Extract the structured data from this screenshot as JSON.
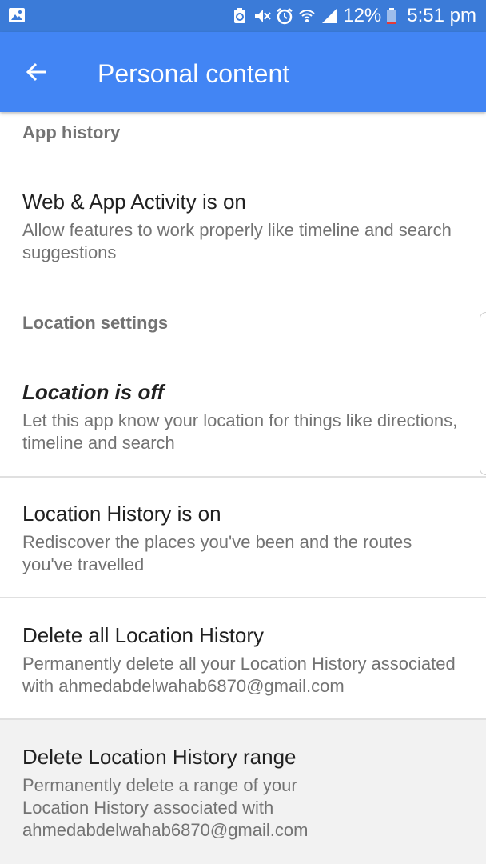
{
  "status_bar": {
    "battery": "12%",
    "time": "5:51 pm",
    "icons": [
      "image-icon",
      "sync-icon",
      "mute-icon",
      "alarm-icon",
      "wifi-icon",
      "signal-icon",
      "battery-icon"
    ]
  },
  "app_bar": {
    "title": "Personal content",
    "back_icon": "arrow-left-icon"
  },
  "sections": {
    "app_history": "App history",
    "location_settings": "Location settings"
  },
  "items": {
    "web_app_activity": {
      "title": "Web & App Activity is on",
      "subtitle": "Allow features to work properly like timeline and search suggestions"
    },
    "location": {
      "title": "Location is off",
      "subtitle": "Let this app know your location for things like directions, timeline and search"
    },
    "location_history": {
      "title": "Location History is on",
      "subtitle": "Rediscover the places you've been and the routes you've travelled"
    },
    "delete_all": {
      "title": "Delete all Location History",
      "subtitle": "Permanently delete all your Location History associ­ated with ahmedabdelwahab6870@gmail.com"
    },
    "delete_range": {
      "title": "Delete Location History range",
      "subtitle": "Permanently delete a range of your Location History associated with ahmedabdelwahab6870@gmail.com"
    }
  },
  "colors": {
    "status_bar": "#3b7bd8",
    "app_bar": "#4285f4",
    "title_text": "#212121",
    "secondary_text": "#737373",
    "divider": "#e0e0e0"
  }
}
